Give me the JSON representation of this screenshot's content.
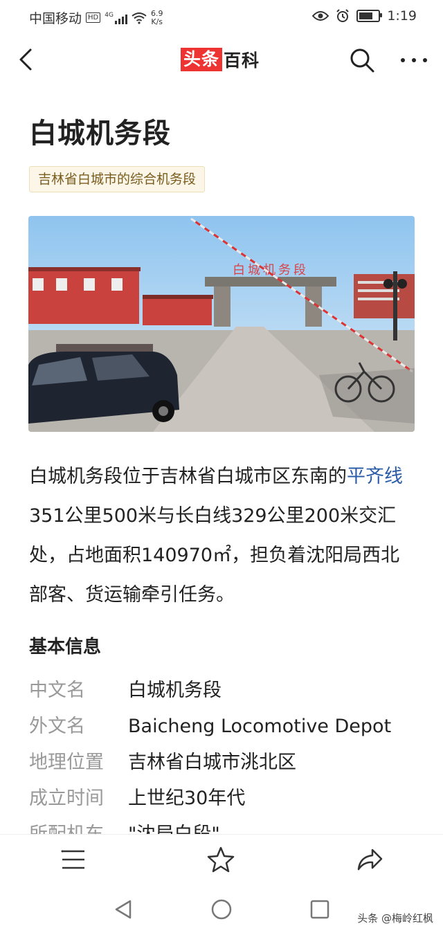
{
  "status": {
    "carrier": "中国移动",
    "hd": "HD",
    "network": "4G",
    "speed_value": "6.9",
    "speed_unit": "K/s",
    "time": "1:19",
    "battery_level": 0.85
  },
  "nav": {
    "brand_part1": "头条",
    "brand_part2": "百科"
  },
  "article": {
    "title": "白城机务段",
    "tag": "吉林省白城市的综合机务段",
    "photo_sign_text": "白城机务段",
    "intro_part1": "白城机务段位于吉林省白城市区东南的",
    "intro_link": "平齐线",
    "intro_part2": "351公里500米与长白线329公里200米交汇处，占地面积140970㎡，担负着沈阳局西北部客、货运输牵引任务。"
  },
  "basic_info": {
    "heading": "基本信息",
    "rows": [
      {
        "key": "中文名",
        "value": "白城机务段"
      },
      {
        "key": "外文名",
        "value": "Baicheng Locomotive Depot"
      },
      {
        "key": "地理位置",
        "value": "吉林省白城市洮北区"
      },
      {
        "key": "成立时间",
        "value": "上世纪30年代"
      },
      {
        "key": "所配机车",
        "value": "\"沈局白段\""
      }
    ]
  },
  "watermark": "头条 @梅岭红枫",
  "colors": {
    "brand_red": "#ee3333",
    "link_blue": "#2a5ca8",
    "tag_bg": "#fbf6e7",
    "tag_text": "#7a5c1e"
  }
}
